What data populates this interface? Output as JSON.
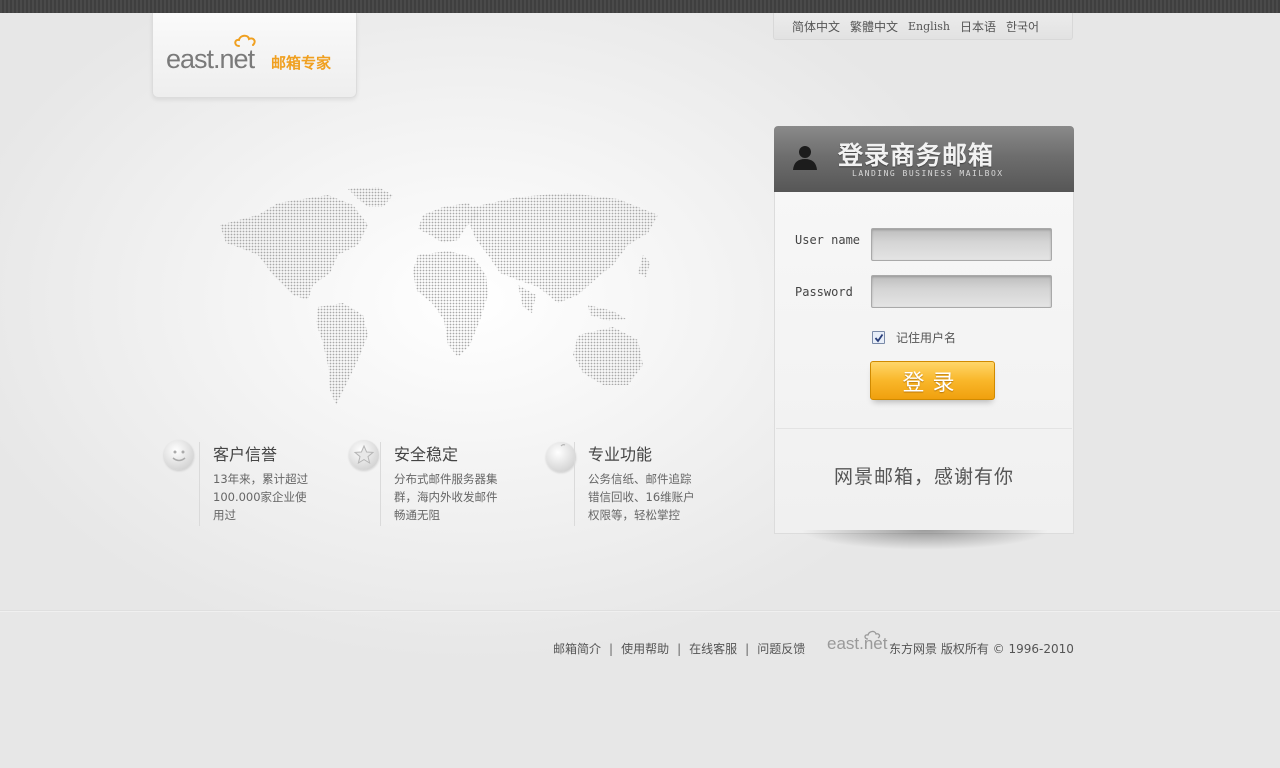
{
  "logo": {
    "english": "east.net",
    "chinese": "邮箱专家"
  },
  "languages": [
    "简体中文",
    "繁體中文",
    "English",
    "日本语",
    "한국어"
  ],
  "features": [
    {
      "title": "客户信誉",
      "desc": "13年来，累计超过100.000家企业使用过"
    },
    {
      "title": "安全稳定",
      "desc": "分布式邮件服务器集群，海内外收发邮件畅通无阻"
    },
    {
      "title": "专业功能",
      "desc": "公务信纸、邮件追踪错信回收、16维账户权限等，轻松掌控"
    }
  ],
  "login": {
    "title": "登录商务邮箱",
    "subtitle": "LANDING BUSINESS MAILBOX",
    "username_label": "User name",
    "username_value": "",
    "password_label": "Password",
    "password_value": "",
    "remember_label": "记住用户名",
    "remember_checked": true,
    "button_label": "登录",
    "slogan": "网景邮箱，感谢有你"
  },
  "footer": {
    "links": [
      "邮箱简介",
      "使用帮助",
      "在线客服",
      "问题反馈"
    ],
    "logo_text": "east.net",
    "copyright": "东方网景 版权所有 © 1996-2010"
  },
  "colors": {
    "accent": "#f0a020",
    "button": "#f9b72a",
    "header": "#6e6e6e"
  }
}
